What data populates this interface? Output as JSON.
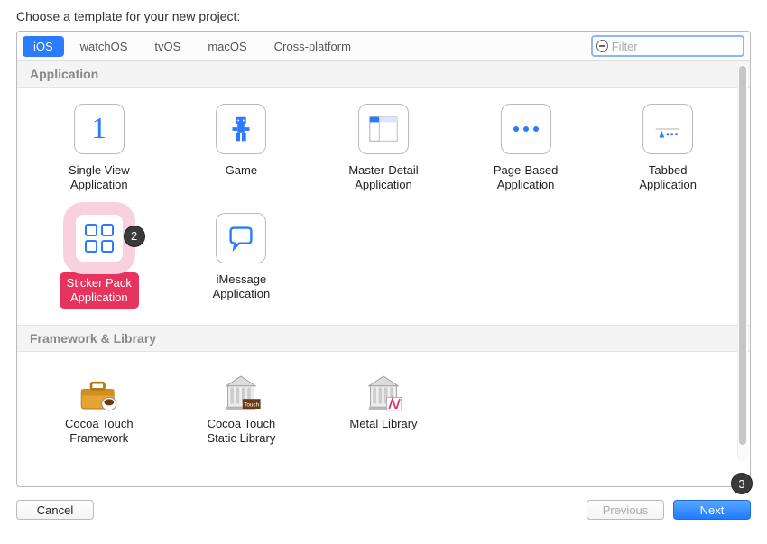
{
  "header": "Choose a template for your new project:",
  "tabs": [
    "iOS",
    "watchOS",
    "tvOS",
    "macOS",
    "Cross-platform"
  ],
  "active_tab_index": 0,
  "filter": {
    "placeholder": "Filter",
    "value": ""
  },
  "sections": [
    {
      "title": "Application",
      "items": [
        {
          "label": "Single View\nApplication",
          "icon": "single-view"
        },
        {
          "label": "Game",
          "icon": "game"
        },
        {
          "label": "Master-Detail\nApplication",
          "icon": "master-detail"
        },
        {
          "label": "Page-Based\nApplication",
          "icon": "page-based"
        },
        {
          "label": "Tabbed\nApplication",
          "icon": "tabbed"
        },
        {
          "label": "Sticker Pack\nApplication",
          "icon": "sticker-pack",
          "selected": true,
          "annotation": "2"
        },
        {
          "label": "iMessage\nApplication",
          "icon": "imessage"
        }
      ]
    },
    {
      "title": "Framework & Library",
      "items": [
        {
          "label": "Cocoa Touch\nFramework",
          "icon": "cocoa-touch-framework"
        },
        {
          "label": "Cocoa Touch\nStatic Library",
          "icon": "cocoa-touch-static"
        },
        {
          "label": "Metal Library",
          "icon": "metal-library"
        }
      ]
    }
  ],
  "buttons": {
    "cancel": "Cancel",
    "previous": "Previous",
    "next": "Next",
    "next_annotation": "3"
  }
}
